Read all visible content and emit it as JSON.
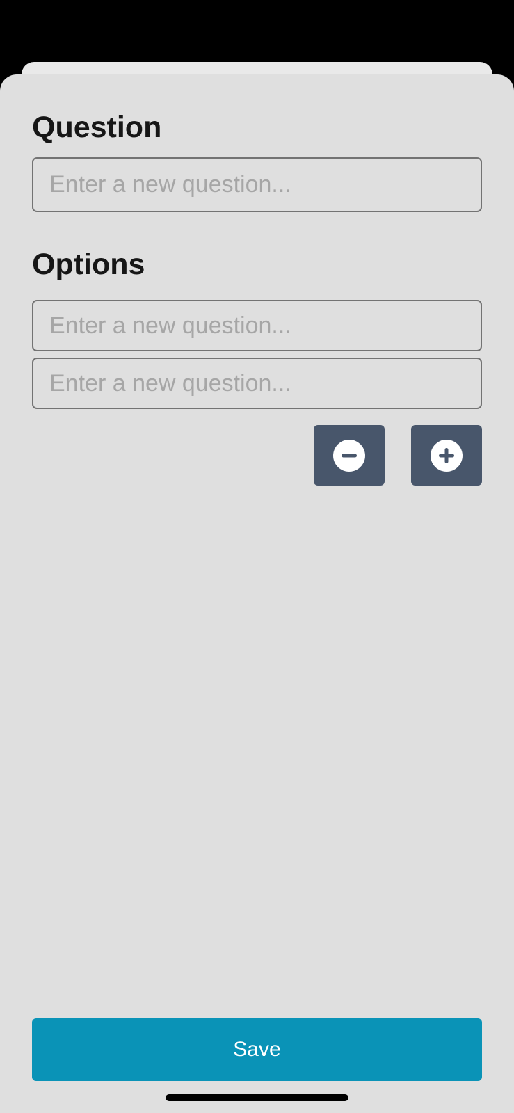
{
  "form": {
    "question_heading": "Question",
    "question_placeholder": "Enter a new question...",
    "options_heading": "Options",
    "options": [
      {
        "placeholder": "Enter a new question..."
      },
      {
        "placeholder": "Enter a new question..."
      }
    ]
  },
  "controls": {
    "remove_icon": "minus-circle-icon",
    "add_icon": "plus-circle-icon",
    "button_color": "#48566b"
  },
  "footer": {
    "save_label": "Save",
    "save_color": "#0a93b7"
  }
}
